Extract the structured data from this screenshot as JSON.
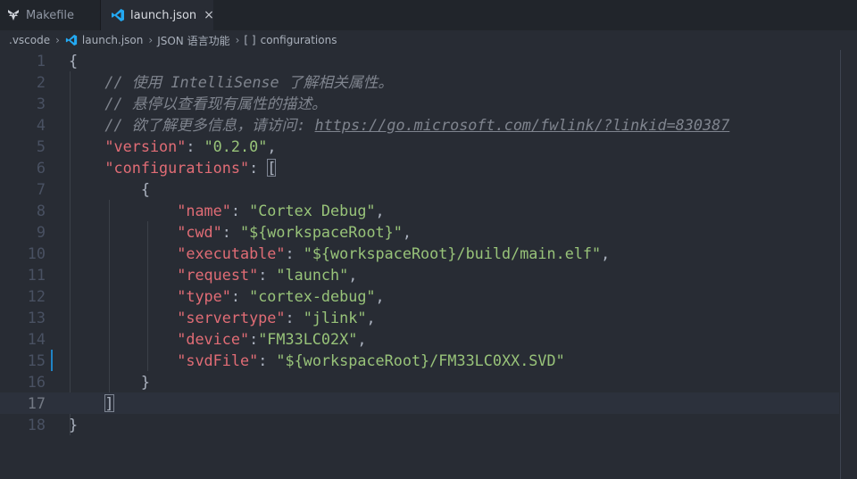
{
  "tabs": [
    {
      "label": "Makefile",
      "icon": "makefile-icon",
      "active": false
    },
    {
      "label": "launch.json",
      "icon": "vscode-icon",
      "active": true,
      "close": "×"
    }
  ],
  "breadcrumb": {
    "folder": ".vscode",
    "file": "launch.json",
    "language": "JSON 语言功能",
    "symbol_icon": "[ ]",
    "symbol": "configurations"
  },
  "editor": {
    "current_line": 17,
    "modified_line": 15,
    "lines": [
      {
        "n": "1",
        "indent": "",
        "tokens": [
          {
            "t": "{",
            "c": "punc"
          }
        ]
      },
      {
        "n": "2",
        "indent": "    ",
        "tokens": [
          {
            "t": "// 使用 IntelliSense 了解相关属性。",
            "c": "cmt"
          }
        ]
      },
      {
        "n": "3",
        "indent": "    ",
        "tokens": [
          {
            "t": "// 悬停以查看现有属性的描述。",
            "c": "cmt"
          }
        ]
      },
      {
        "n": "4",
        "indent": "    ",
        "tokens": [
          {
            "t": "// 欲了解更多信息，请访问: ",
            "c": "cmt"
          },
          {
            "t": "https://go.microsoft.com/fwlink/?linkid=830387",
            "c": "link"
          }
        ]
      },
      {
        "n": "5",
        "indent": "    ",
        "tokens": [
          {
            "t": "\"version\"",
            "c": "key"
          },
          {
            "t": ": ",
            "c": "punc"
          },
          {
            "t": "\"0.2.0\"",
            "c": "str"
          },
          {
            "t": ",",
            "c": "punc"
          }
        ]
      },
      {
        "n": "6",
        "indent": "    ",
        "tokens": [
          {
            "t": "\"configurations\"",
            "c": "key"
          },
          {
            "t": ": ",
            "c": "punc"
          },
          {
            "t": "[",
            "c": "punc",
            "match": true
          }
        ]
      },
      {
        "n": "7",
        "indent": "        ",
        "tokens": [
          {
            "t": "{",
            "c": "punc"
          }
        ]
      },
      {
        "n": "8",
        "indent": "            ",
        "tokens": [
          {
            "t": "\"name\"",
            "c": "key"
          },
          {
            "t": ": ",
            "c": "punc"
          },
          {
            "t": "\"Cortex Debug\"",
            "c": "str"
          },
          {
            "t": ",",
            "c": "punc"
          }
        ]
      },
      {
        "n": "9",
        "indent": "            ",
        "tokens": [
          {
            "t": "\"cwd\"",
            "c": "key"
          },
          {
            "t": ": ",
            "c": "punc"
          },
          {
            "t": "\"${workspaceRoot}\"",
            "c": "str"
          },
          {
            "t": ",",
            "c": "punc"
          }
        ]
      },
      {
        "n": "10",
        "indent": "            ",
        "tokens": [
          {
            "t": "\"executable\"",
            "c": "key"
          },
          {
            "t": ": ",
            "c": "punc"
          },
          {
            "t": "\"${workspaceRoot}/build/main.elf\"",
            "c": "str"
          },
          {
            "t": ",",
            "c": "punc"
          }
        ]
      },
      {
        "n": "11",
        "indent": "            ",
        "tokens": [
          {
            "t": "\"request\"",
            "c": "key"
          },
          {
            "t": ": ",
            "c": "punc"
          },
          {
            "t": "\"launch\"",
            "c": "str"
          },
          {
            "t": ",",
            "c": "punc"
          }
        ]
      },
      {
        "n": "12",
        "indent": "            ",
        "tokens": [
          {
            "t": "\"type\"",
            "c": "key"
          },
          {
            "t": ": ",
            "c": "punc"
          },
          {
            "t": "\"cortex-debug\"",
            "c": "str"
          },
          {
            "t": ",",
            "c": "punc"
          }
        ]
      },
      {
        "n": "13",
        "indent": "            ",
        "tokens": [
          {
            "t": "\"servertype\"",
            "c": "key"
          },
          {
            "t": ": ",
            "c": "punc"
          },
          {
            "t": "\"jlink\"",
            "c": "str"
          },
          {
            "t": ",",
            "c": "punc"
          }
        ]
      },
      {
        "n": "14",
        "indent": "            ",
        "tokens": [
          {
            "t": "\"device\"",
            "c": "key"
          },
          {
            "t": ":",
            "c": "punc"
          },
          {
            "t": "\"FM33LC02X\"",
            "c": "str"
          },
          {
            "t": ",",
            "c": "punc"
          }
        ]
      },
      {
        "n": "15",
        "indent": "            ",
        "tokens": [
          {
            "t": "\"svdFile\"",
            "c": "key"
          },
          {
            "t": ": ",
            "c": "punc"
          },
          {
            "t": "\"${workspaceRoot}/FM33LC0XX.SVD\"",
            "c": "str"
          }
        ]
      },
      {
        "n": "16",
        "indent": "        ",
        "tokens": [
          {
            "t": "}",
            "c": "punc"
          }
        ]
      },
      {
        "n": "17",
        "indent": "    ",
        "tokens": [
          {
            "t": "]",
            "c": "punc",
            "match": true
          }
        ]
      },
      {
        "n": "18",
        "indent": "",
        "tokens": [
          {
            "t": "}",
            "c": "punc"
          }
        ]
      }
    ]
  },
  "colors": {
    "background": "#282c34",
    "tabbar": "#21252b",
    "key": "#e06c75",
    "string": "#98c379",
    "comment": "#7f848e",
    "modified_marker": "#2083c5",
    "vscode_blue": "#23a9f2"
  }
}
